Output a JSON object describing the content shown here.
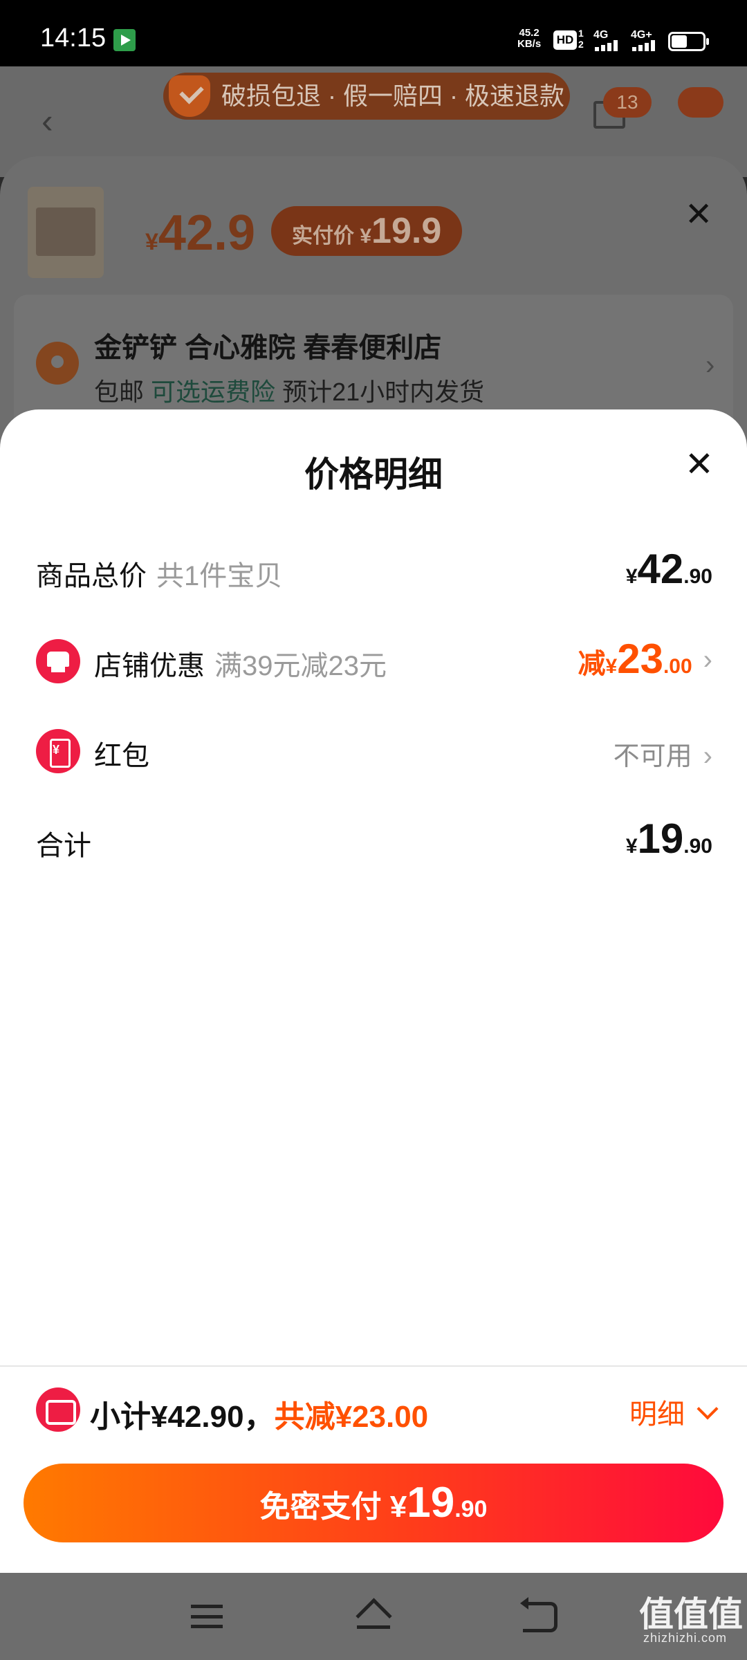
{
  "status_bar": {
    "time": "14:15",
    "net_speed": "45.2",
    "net_unit": "KB/s",
    "hd_label": "HD",
    "hd_sup": "1",
    "hd_sub": "2",
    "sig1_label": "4G",
    "sig2_label": "4G+"
  },
  "background_page": {
    "banner_text": "破损包退 · 假一赔四 · 极速退款",
    "cart_count": "13"
  },
  "sku_sheet": {
    "price_yen": "¥",
    "price": "42.9",
    "actual_label": "实付价",
    "actual_yen": "¥",
    "actual_price": "19.9",
    "address_name": "金铲铲 合心雅院 春春便利店",
    "shipping_free": "包邮",
    "shipping_insurance": "可选运费险",
    "shipping_time": "预计21小时内发货"
  },
  "price_detail": {
    "title": "价格明细",
    "rows": {
      "total": {
        "label": "商品总价",
        "hint": "共1件宝贝",
        "yen": "¥",
        "int": "42",
        "dec": ".90"
      },
      "shop": {
        "label": "店铺优惠",
        "hint": "满39元减23元",
        "prefix": "减",
        "yen": "¥",
        "int": "23",
        "dec": ".00"
      },
      "redpack": {
        "label": "红包",
        "value": "不可用"
      },
      "sum": {
        "label": "合计",
        "yen": "¥",
        "int": "19",
        "dec": ".90"
      }
    }
  },
  "footer": {
    "subtotal_text": "小计¥42.90，",
    "discount_text": "共减¥23.00",
    "detail_label": "明细",
    "pay_label": "免密支付",
    "pay_yen": "¥",
    "pay_int": "19",
    "pay_dec": ".90"
  },
  "watermark": {
    "text": "值值值",
    "sub": "zhizhizhi.com"
  },
  "colors": {
    "accent": "#ff5000",
    "icon_red": "#ee1d44",
    "pay_gradient_start": "#ff7a00",
    "pay_gradient_end": "#ff0a3c"
  }
}
